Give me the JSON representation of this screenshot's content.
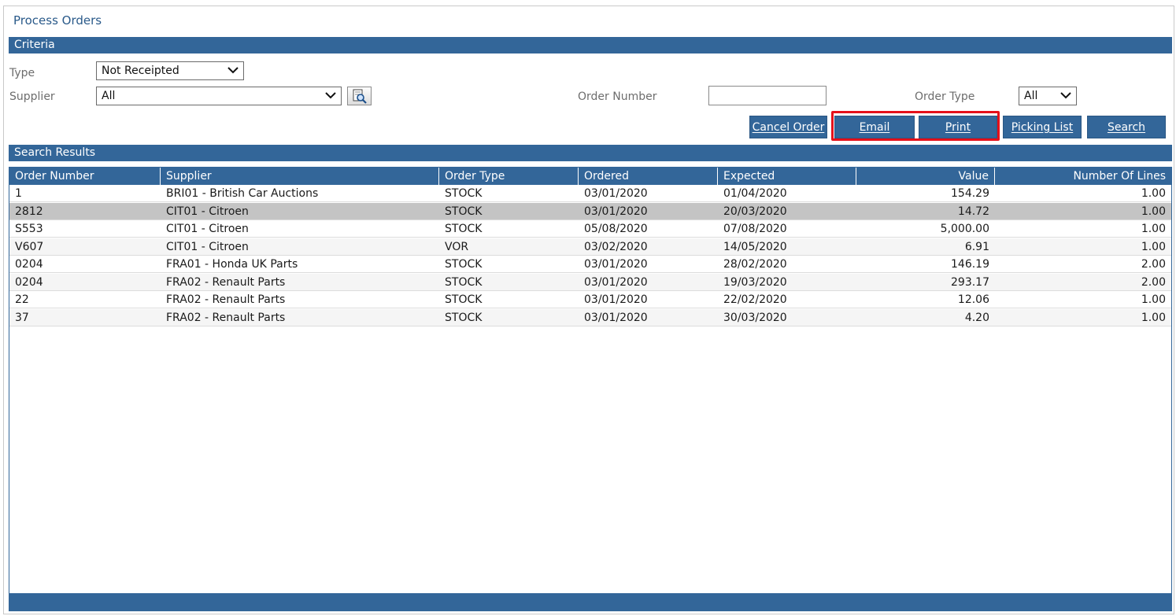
{
  "page": {
    "title": "Process Orders"
  },
  "criteria": {
    "header": "Criteria",
    "type_label": "Type",
    "type_value": "Not Receipted",
    "supplier_label": "Supplier",
    "supplier_value": "All",
    "order_number_label": "Order Number",
    "order_number_value": "",
    "order_type_label": "Order Type",
    "order_type_value": "All"
  },
  "actions": {
    "cancel_order": "Cancel Order",
    "email": "Email",
    "print": "Print",
    "picking_list": "Picking List",
    "search": "Search"
  },
  "results": {
    "header": "Search Results",
    "columns": [
      "Order Number",
      "Supplier",
      "Order Type",
      "Ordered",
      "Expected",
      "Value",
      "Number Of Lines"
    ],
    "rows": [
      [
        "1",
        "BRI01 - British Car Auctions",
        "STOCK",
        "03/01/2020",
        "01/04/2020",
        "154.29",
        "1.00"
      ],
      [
        "2812",
        "CIT01 - Citroen",
        "STOCK",
        "03/01/2020",
        "20/03/2020",
        "14.72",
        "1.00"
      ],
      [
        "S553",
        "CIT01 - Citroen",
        "STOCK",
        "05/08/2020",
        "07/08/2020",
        "5,000.00",
        "1.00"
      ],
      [
        "V607",
        "CIT01 - Citroen",
        "VOR",
        "03/02/2020",
        "14/05/2020",
        "6.91",
        "1.00"
      ],
      [
        "0204",
        "FRA01 - Honda UK Parts",
        "STOCK",
        "03/01/2020",
        "28/02/2020",
        "146.19",
        "2.00"
      ],
      [
        "0204",
        "FRA02 - Renault Parts",
        "STOCK",
        "03/01/2020",
        "19/03/2020",
        "293.17",
        "2.00"
      ],
      [
        "22",
        "FRA02 - Renault Parts",
        "STOCK",
        "03/01/2020",
        "22/02/2020",
        "12.06",
        "1.00"
      ],
      [
        "37",
        "FRA02 - Renault Parts",
        "STOCK",
        "03/01/2020",
        "30/03/2020",
        "4.20",
        "1.00"
      ]
    ],
    "selected_row": 1
  },
  "icons": {
    "dropdown": "chevron-down-icon",
    "lookup": "magnifier-document-icon"
  },
  "colors": {
    "band": "#336699",
    "title": "#2a5a8a",
    "selected_row": "#c4c4c4",
    "alt_row": "#f5f5f5",
    "highlight": "#e5101a"
  }
}
